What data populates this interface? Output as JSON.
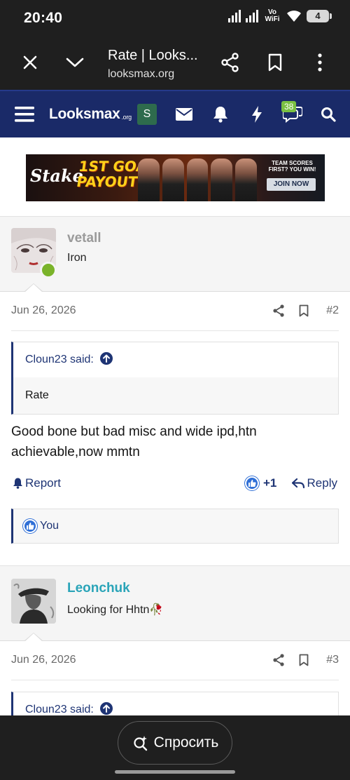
{
  "status_bar": {
    "time": "20:40",
    "network": "Vo WiFi",
    "battery": "4"
  },
  "browser": {
    "page_title": "Rate | Looks...",
    "url": "looksmax.org"
  },
  "site_header": {
    "logo_main": "Looksmax",
    "logo_suffix": ".org",
    "user_initial": "S",
    "chat_badge": "38"
  },
  "ad": {
    "brand": "Stake",
    "headline_1": "1ST GOAL",
    "headline_2": "PAYOUT",
    "tagline_1": "TEAM SCORES",
    "tagline_2": "FIRST? YOU WIN!",
    "cta": "JOIN NOW"
  },
  "posts": [
    {
      "username": "vetall",
      "username_color": "#9a9a9a",
      "user_title": "Iron",
      "online": true,
      "date": "Jun 26, 2026",
      "post_number": "#2",
      "quote_author": "Cloun23 said:",
      "quote_text": "Rate",
      "message": "Good bone but bad misc and wide ipd,htn achievable,now mmtn",
      "report_label": "Report",
      "reaction_count": "+1",
      "reply_label": "Reply",
      "reactions_by": "You"
    },
    {
      "username": "Leonchuk",
      "username_color": "#2aa4b8",
      "user_title": "Looking for Hhtn",
      "user_title_emoji": "🥀",
      "date": "Jun 26, 2026",
      "post_number": "#3",
      "quote_author": "Cloun23 said:"
    }
  ],
  "bottom": {
    "ask_label": "Спросить"
  }
}
